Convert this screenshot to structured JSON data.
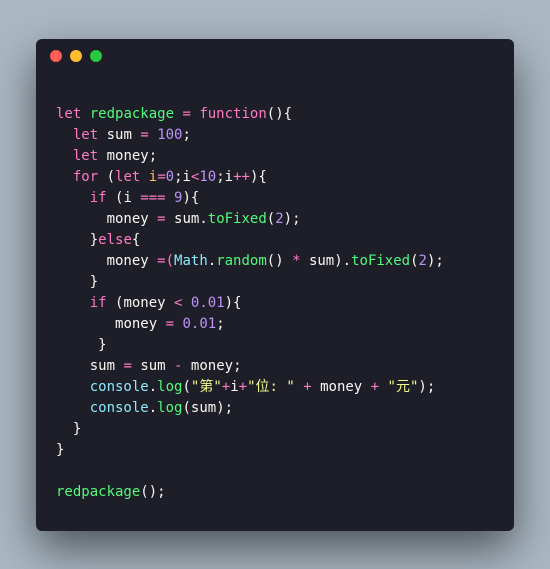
{
  "colors": {
    "page_bg": "#abb8c3",
    "window_bg": "#1e1e28",
    "traffic_close": "#ff5f56",
    "traffic_min": "#ffbd2e",
    "traffic_max": "#27c93f"
  },
  "code": {
    "l01_let": "let",
    "l01_name": "redpackage",
    "l01_eq": " = ",
    "l01_func": "function",
    "l01_tail": "(){",
    "l02_let": "let",
    "l02_var": "sum",
    "l02_eq": " = ",
    "l02_val": "100",
    "l02_sc": ";",
    "l03_let": "let",
    "l03_var": "money",
    "l03_sc": ";",
    "l04_for": "for",
    "l04_op1": " (",
    "l04_let": "let",
    "l04_sp": " ",
    "l04_i1": "i",
    "l04_eq": "=",
    "l04_z": "0",
    "l04_sc1": ";",
    "l04_i2": "i",
    "l04_lt": "<",
    "l04_ten": "10",
    "l04_sc2": ";",
    "l04_i3": "i",
    "l04_pp": "++",
    "l04_tail": "){",
    "l05_if": "if",
    "l05_op": " (",
    "l05_i": "i",
    "l05_eqq": " === ",
    "l05_9": "9",
    "l05_tail": "){",
    "l06_m": "money",
    "l06_eq": " = ",
    "l06_s": "sum",
    "l06_dot": ".",
    "l06_fn": "toFixed",
    "l06_op": "(",
    "l06_2": "2",
    "l06_cl": ");",
    "l07_txt": "}",
    "l07_else": "else",
    "l07_br": "{",
    "l08_m": "money",
    "l08_eq": " =(",
    "l08_math": "Math",
    "l08_dot1": ".",
    "l08_rand": "random",
    "l08_p1": "() ",
    "l08_star": "*",
    "l08_sp": " ",
    "l08_sum": "sum",
    "l08_p2": ").",
    "l08_tf": "toFixed",
    "l08_p3": "(",
    "l08_2": "2",
    "l08_p4": ");",
    "l09_txt": "}",
    "l10_if": "if",
    "l10_op": " (",
    "l10_m": "money",
    "l10_lt": " < ",
    "l10_v": "0.01",
    "l10_tail": "){",
    "l11_m": "money",
    "l11_eq": " = ",
    "l11_v": "0.01",
    "l11_sc": ";",
    "l12_txt": "}",
    "l13_s": "sum",
    "l13_eq": " = ",
    "l13_s2": "sum",
    "l13_mn": " - ",
    "l13_m": "money",
    "l13_sc": ";",
    "l14_c": "console",
    "l14_d": ".",
    "l14_l": "log",
    "l14_op": "(",
    "l14_s1": "\"第\"",
    "l14_p1": "+",
    "l14_i": "i",
    "l14_p2": "+",
    "l14_s2": "\"位: \"",
    "l14_p3": " + ",
    "l14_m": "money",
    "l14_p4": " + ",
    "l14_s3": "\"元\"",
    "l14_cl": ");",
    "l15_c": "console",
    "l15_d": ".",
    "l15_l": "log",
    "l15_op": "(",
    "l15_s": "sum",
    "l15_cl": ");",
    "l16_txt": "}",
    "l17_txt": "}",
    "l19_fn": "redpackage",
    "l19_tail": "();"
  }
}
